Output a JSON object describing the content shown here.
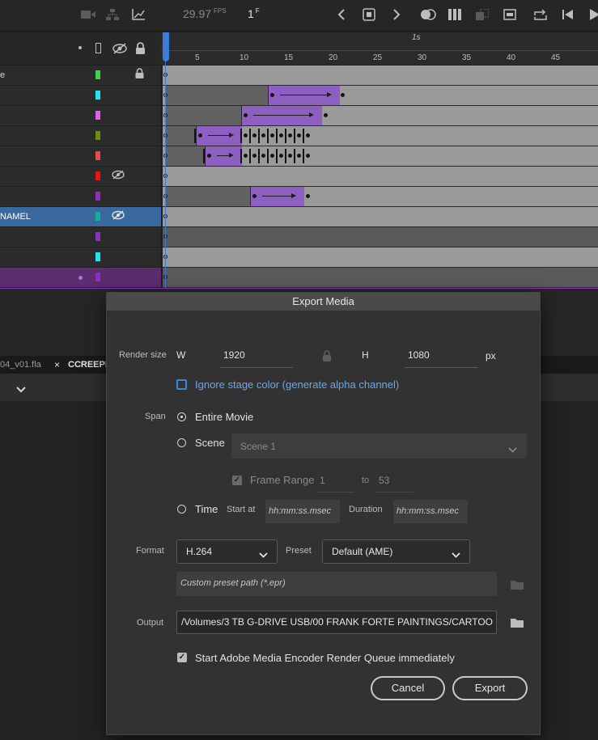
{
  "toolbar": {
    "fps_value": "29.97",
    "fps_unit": "FPS",
    "frame_value": "1",
    "frame_unit": "F"
  },
  "timeline": {
    "ruler_marker": "1s",
    "frame_labels": [
      "5",
      "10",
      "15",
      "20",
      "25",
      "30",
      "35",
      "40",
      "45"
    ],
    "layers": [
      {
        "name": "e",
        "color": "#3fd24a",
        "hidden": false,
        "locked": true,
        "selected": false
      },
      {
        "name": "",
        "color": "#26e3ee",
        "hidden": false,
        "locked": false,
        "selected": false
      },
      {
        "name": "",
        "color": "#e35de8",
        "hidden": false,
        "locked": false,
        "selected": false
      },
      {
        "name": "",
        "color": "#6f8a16",
        "hidden": false,
        "locked": false,
        "selected": false
      },
      {
        "name": "",
        "color": "#e64b4b",
        "hidden": false,
        "locked": false,
        "selected": false
      },
      {
        "name": "",
        "color": "#e11616",
        "hidden": true,
        "locked": false,
        "selected": false
      },
      {
        "name": "",
        "color": "#8d2fc4",
        "hidden": false,
        "locked": false,
        "selected": false
      },
      {
        "name": "NAMEL",
        "color": "#1aa9a0",
        "hidden": true,
        "locked": false,
        "selected": true
      },
      {
        "name": "",
        "color": "#8d2fc4",
        "hidden": false,
        "locked": false,
        "selected": false
      },
      {
        "name": "",
        "color": "#26e3ee",
        "hidden": false,
        "locked": false,
        "selected": false
      },
      {
        "name": "",
        "color": "#8d2fc4",
        "hidden": false,
        "locked": false,
        "selected": false
      }
    ]
  },
  "doc_tabs": {
    "tab1": "04_v01.fla",
    "tab2_close": "×",
    "tab2": "CCREEPIE"
  },
  "dialog": {
    "title": "Export Media",
    "render_size_label": "Render size",
    "w_label": "W",
    "w_value": "1920",
    "h_label": "H",
    "h_value": "1080",
    "px_label": "px",
    "ignore_stage_label": "Ignore stage color (generate alpha channel)",
    "ignore_stage_checked": false,
    "span_label": "Span",
    "entire_movie_label": "Entire Movie",
    "scene_label": "Scene",
    "scene_value": "Scene 1",
    "frame_range_label": "Frame Range",
    "frame_from": "1",
    "to_label": "to",
    "frame_to": "53",
    "time_label": "Time",
    "start_at_label": "Start at",
    "start_at_placeholder": "hh:mm:ss.msec",
    "duration_label": "Duration",
    "duration_placeholder": "hh:mm:ss.msec",
    "format_label": "Format",
    "format_value": "H.264",
    "preset_label": "Preset",
    "preset_value": "Default (AME)",
    "custom_preset_placeholder": "Custom preset path (*.epr)",
    "output_label": "Output",
    "output_value": "/Volumes/3 TB G-DRIVE USB/00 FRANK FORTE PAINTINGS/CARTOO",
    "start_queue_label": "Start Adobe Media Encoder Render Queue immediately",
    "start_queue_checked": true,
    "cancel_label": "Cancel",
    "export_label": "Export",
    "selected_span": "Entire Movie"
  }
}
